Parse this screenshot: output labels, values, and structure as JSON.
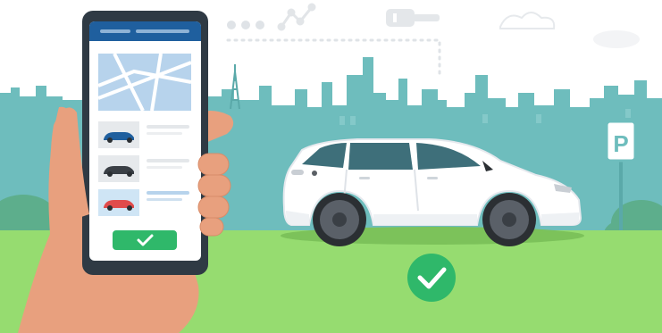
{
  "scene": {
    "description_kind": "illustration",
    "colors": {
      "sky": "#ffffff",
      "skyline": "#6ebdbd",
      "grass": "#96dc70",
      "accent_blue": "#1f5f9e",
      "check_green": "#2fb86a",
      "hand": "#e8a07e",
      "phone": "#2f3a44",
      "car_body": "#ffffff",
      "wheel": "#4a4f55"
    },
    "icons": {
      "parking_sign_letter": "P",
      "sky_icons": [
        "dots-icon",
        "line-graph-icon",
        "car-key-icon",
        "cloud-icon"
      ]
    },
    "phone_list": [
      {
        "car_color": "#1f5f9e",
        "selected": false
      },
      {
        "car_color": "#3a3f45",
        "selected": false
      },
      {
        "car_color": "#e04b4b",
        "selected": true
      }
    ]
  }
}
